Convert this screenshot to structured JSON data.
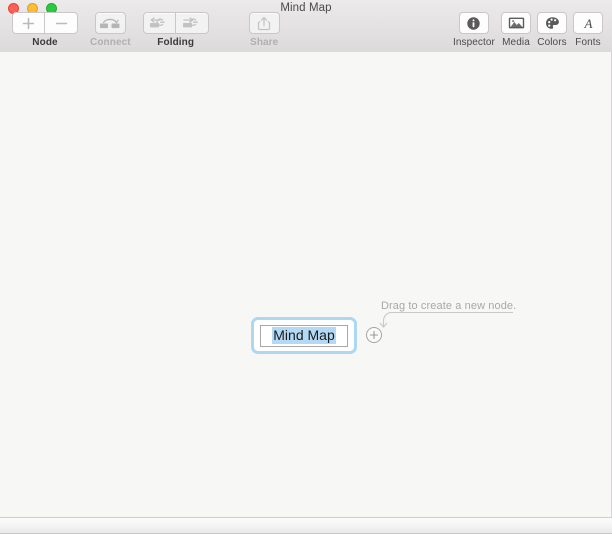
{
  "window": {
    "title": "Mind Map",
    "controls": [
      {
        "name": "close",
        "label": "Close"
      },
      {
        "name": "minimize",
        "label": "Minimize"
      },
      {
        "name": "zoom",
        "label": "Zoom"
      }
    ]
  },
  "toolbar": {
    "left_groups": [
      {
        "label": "Node",
        "enabled": true,
        "buttons": [
          {
            "icon": "plus-icon",
            "label": "Add Node",
            "enabled": true
          },
          {
            "icon": "minus-icon",
            "label": "Remove Node",
            "enabled": true
          }
        ]
      },
      {
        "label": "Connect",
        "enabled": false,
        "buttons": [
          {
            "icon": "connect-nodes-icon",
            "label": "Connect Nodes",
            "enabled": false
          }
        ]
      },
      {
        "label": "Folding",
        "enabled": true,
        "buttons": [
          {
            "icon": "fold-left-icon",
            "label": "Fold",
            "enabled": false
          },
          {
            "icon": "unfold-right-icon",
            "label": "Unfold",
            "enabled": false
          }
        ]
      },
      {
        "label": "Share",
        "enabled": false,
        "buttons": [
          {
            "icon": "share-icon",
            "label": "Share",
            "enabled": false
          }
        ]
      }
    ],
    "right_items": [
      {
        "label": "Inspector",
        "icon": "info-circle-icon"
      },
      {
        "label": "Media",
        "icon": "media-photo-icon"
      },
      {
        "label": "Colors",
        "icon": "color-palette-icon"
      },
      {
        "label": "Fonts",
        "icon": "font-a-icon"
      }
    ]
  },
  "canvas": {
    "node": {
      "text": "Mind Map",
      "selected": true,
      "editing": true,
      "text_selected": true
    },
    "hint": {
      "text": "Drag to create a new node.",
      "plus_button_label": "+"
    }
  },
  "colors": {
    "selection_ring": "#aed7f2",
    "text_highlight": "#b4d9f4",
    "canvas_background": "#f7f7f5",
    "toolbar_background": "#e3e1e1",
    "hint_text": "#aaa8a8",
    "close_light": "#ff6054",
    "minimize_light": "#ffbe2f",
    "zoom_light": "#2bc940"
  }
}
